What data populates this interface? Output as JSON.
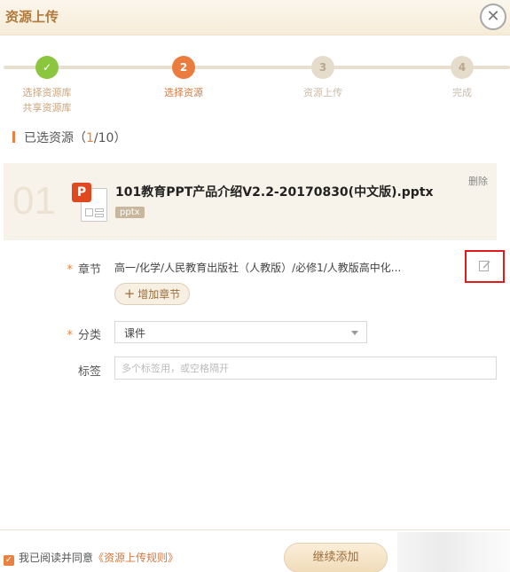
{
  "dialog": {
    "title": "资源上传",
    "close_glyph": "✕"
  },
  "steps": [
    {
      "number": "✓",
      "label_line1": "选择资源库",
      "label_line2": "共享资源库",
      "state": "done"
    },
    {
      "number": "2",
      "label_line1": "选择资源",
      "label_line2": "",
      "state": "active"
    },
    {
      "number": "3",
      "label_line1": "资源上传",
      "label_line2": "",
      "state": "todo"
    },
    {
      "number": "4",
      "label_line1": "完成",
      "label_line2": "",
      "state": "todo"
    }
  ],
  "selected": {
    "label": "已选资源",
    "open": "（",
    "current": "1",
    "total": "/10",
    "close": "）"
  },
  "file": {
    "index": "01",
    "icon_letter": "P",
    "name": "101教育PPT产品介绍V2.2-20170830(中文版).pptx",
    "type_tag": "pptx",
    "delete_label": "删除"
  },
  "form": {
    "required_mark": "*",
    "chapter_label": "章节",
    "chapter_value": "高一/化学/人民教育出版社（人教版）/必修1/人教版高中化...",
    "add_chapter_label": "增加章节",
    "category_label": "分类",
    "category_value": "课件",
    "tags_label": "标签",
    "tags_placeholder": "多个标签用，或空格隔开"
  },
  "footer": {
    "agree_text": "我已阅读并同意",
    "rules_link": "《资源上传规则》",
    "continue_label": "继续添加"
  },
  "colors": {
    "accent": "#e9823e",
    "title": "#b07a3c",
    "done_step": "#8cc63f",
    "highlight_box": "#e11b1b"
  },
  "icons": {
    "close": "close-icon",
    "check": "check-icon",
    "file_type": "ppt-file-icon",
    "edit": "edit-icon",
    "plus": "plus-icon",
    "caret": "chevron-down-icon"
  }
}
